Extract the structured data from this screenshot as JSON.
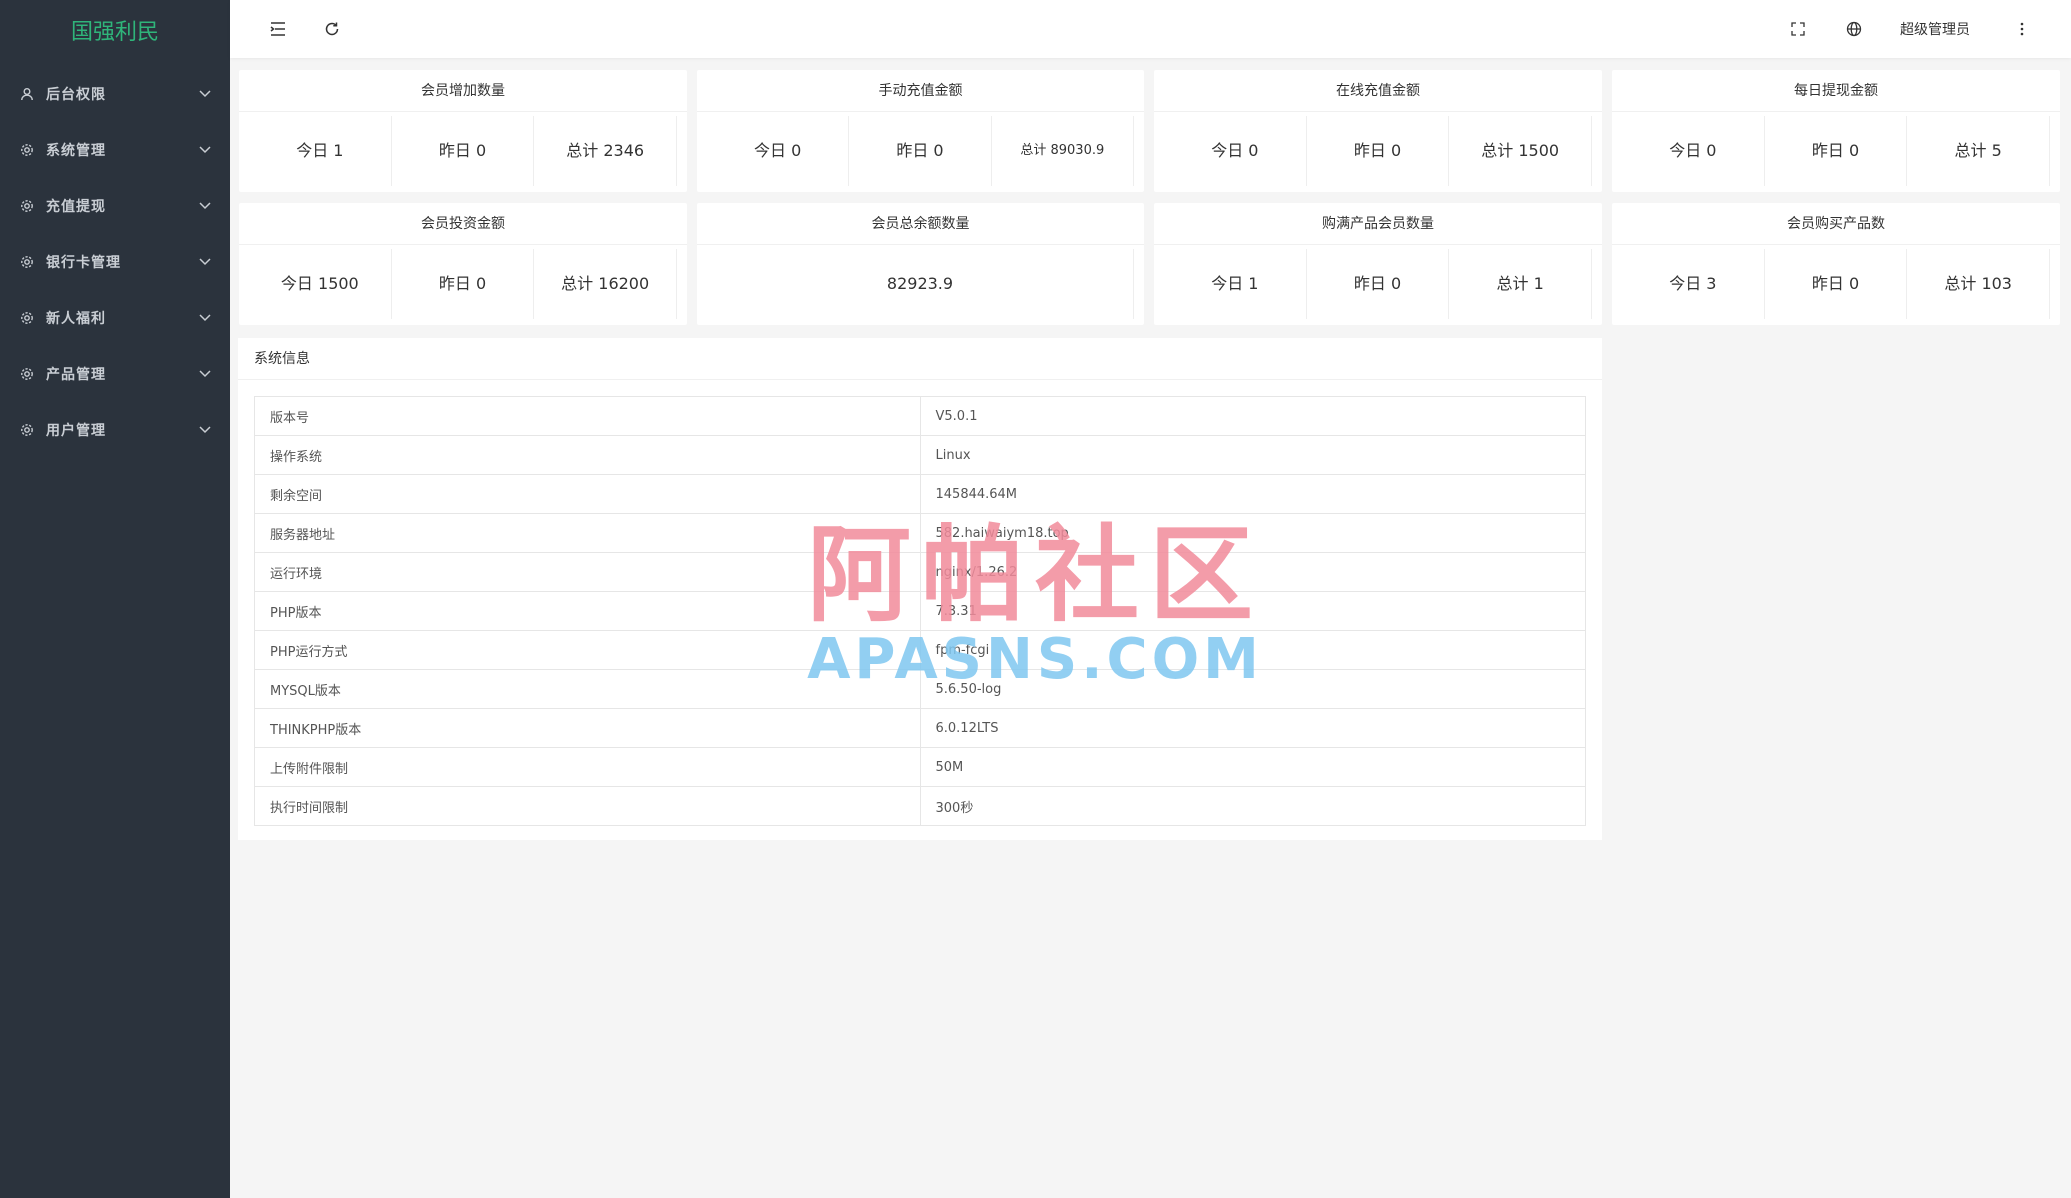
{
  "app": {
    "logo": "国强利民"
  },
  "sidebar": {
    "items": [
      {
        "label": "后台权限",
        "icon": "user-icon"
      },
      {
        "label": "系统管理",
        "icon": "gear-icon"
      },
      {
        "label": "充值提现",
        "icon": "gear-icon"
      },
      {
        "label": "银行卡管理",
        "icon": "gear-icon"
      },
      {
        "label": "新人福利",
        "icon": "gear-icon"
      },
      {
        "label": "产品管理",
        "icon": "gear-icon"
      },
      {
        "label": "用户管理",
        "icon": "gear-icon"
      }
    ]
  },
  "topbar": {
    "user": "超级管理员"
  },
  "cards": [
    {
      "title": "会员增加数量",
      "cells": [
        "今日 1",
        "昨日 0",
        "总计 2346"
      ]
    },
    {
      "title": "手动充值金额",
      "cells": [
        "今日 0",
        "昨日 0",
        "总计 89030.9"
      ]
    },
    {
      "title": "在线充值金额",
      "cells": [
        "今日 0",
        "昨日 0",
        "总计 1500"
      ]
    },
    {
      "title": "每日提现金额",
      "cells": [
        "今日 0",
        "昨日 0",
        "总计 5"
      ]
    },
    {
      "title": "会员投资金额",
      "cells": [
        "今日 1500",
        "昨日 0",
        "总计 16200"
      ]
    },
    {
      "title": "会员总余额数量",
      "cells": [
        "82923.9"
      ]
    },
    {
      "title": "购满产品会员数量",
      "cells": [
        "今日 1",
        "昨日 0",
        "总计 1"
      ]
    },
    {
      "title": "会员购买产品数",
      "cells": [
        "今日 3",
        "昨日 0",
        "总计 103"
      ]
    }
  ],
  "sysinfo": {
    "title": "系统信息",
    "rows": [
      {
        "k": "版本号",
        "v": "V5.0.1"
      },
      {
        "k": "操作系统",
        "v": "Linux"
      },
      {
        "k": "剩余空间",
        "v": "145844.64M"
      },
      {
        "k": "服务器地址",
        "v": "582.haiwaiym18.top"
      },
      {
        "k": "运行环境",
        "v": "nginx/1.26.2"
      },
      {
        "k": "PHP版本",
        "v": "7.3.31"
      },
      {
        "k": "PHP运行方式",
        "v": "fpm-fcgi"
      },
      {
        "k": "MYSQL版本",
        "v": "5.6.50-log"
      },
      {
        "k": "THINKPHP版本",
        "v": "6.0.12LTS"
      },
      {
        "k": "上传附件限制",
        "v": "50M"
      },
      {
        "k": "执行时间限制",
        "v": "300秒"
      }
    ]
  },
  "watermark": {
    "cn": "阿帕社区",
    "en": "APASNS.COM"
  },
  "colors": {
    "sidebar_bg": "#2b333d",
    "logo": "#2fb57a",
    "watermark_cn": "#f28b9b",
    "watermark_en": "#7fc7f0"
  }
}
